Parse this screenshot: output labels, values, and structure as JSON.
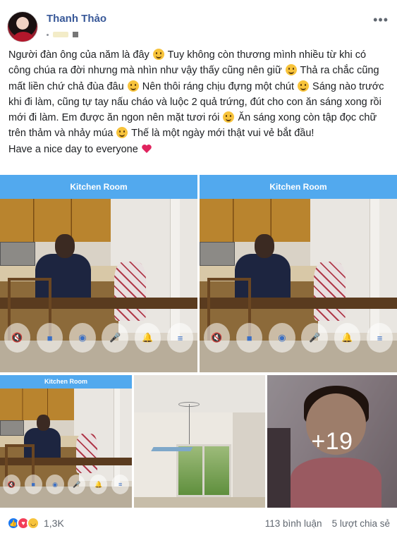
{
  "post": {
    "author": "Thanh Thảo",
    "more_label": "•••",
    "body_lines": [
      "Người đàn ông của năm là đây ",
      " Tuy không còn thương mình nhiều từ khi có công chúa ra đời nhưng mà nhìn như vậy thấy cũng nên giữ ",
      " Thả ra chắc cũng mất liền chứ chả đùa đâu ",
      " Nên thôi ráng chịu đựng một chút ",
      " Sáng nào trước khi đi làm, cũng tự tay nấu cháo và luộc 2 quả trứng, đút cho con ăn sáng xong rồi mới đi làm. Em được ăn ngon nên mặt tươi rói ",
      " Ăn sáng xong còn tập đọc chữ trên thảm và nhảy múa ",
      " Thế là một ngày mới thật vui vẻ bắt đầu!"
    ],
    "last_line": "Have a nice day to everyone "
  },
  "photos": {
    "camera_label": "Kitchen Room",
    "more_count": "+19"
  },
  "footer": {
    "reaction_count": "1,3K",
    "comments": "113 bình luận",
    "shares": "5 lượt chia sẻ"
  },
  "colors": {
    "author": "#385898",
    "camera_bar": "#52a9ee",
    "like": "#1877f2",
    "love": "#f33e58",
    "haha": "#f7c33b"
  }
}
